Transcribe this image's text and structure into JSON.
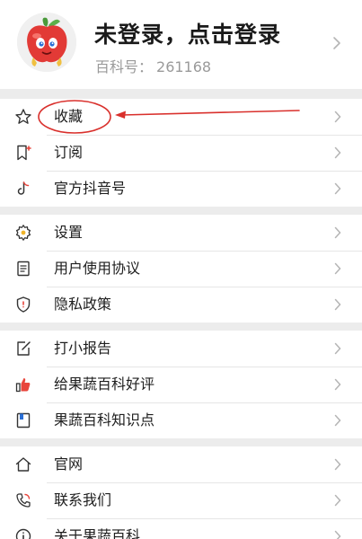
{
  "profile": {
    "title": "未登录，点击登录",
    "id_label": "百科号：",
    "id_value": "261168"
  },
  "groups": [
    {
      "items": [
        {
          "label": "收藏",
          "icon": "star-icon"
        },
        {
          "label": "订阅",
          "icon": "bookmark-plus-icon"
        },
        {
          "label": "官方抖音号",
          "icon": "tiktok-icon"
        }
      ]
    },
    {
      "items": [
        {
          "label": "设置",
          "icon": "gear-icon"
        },
        {
          "label": "用户使用协议",
          "icon": "document-icon"
        },
        {
          "label": "隐私政策",
          "icon": "shield-icon"
        }
      ]
    },
    {
      "items": [
        {
          "label": "打小报告",
          "icon": "edit-icon"
        },
        {
          "label": "给果蔬百科好评",
          "icon": "thumbs-up-icon"
        },
        {
          "label": "果蔬百科知识点",
          "icon": "book-icon"
        }
      ]
    },
    {
      "items": [
        {
          "label": "官网",
          "icon": "home-icon"
        },
        {
          "label": "联系我们",
          "icon": "phone-icon"
        },
        {
          "label": "关于果蔬百科",
          "icon": "info-icon"
        }
      ]
    }
  ],
  "colors": {
    "annotation": "#d9302c",
    "accent_red": "#e8453c"
  }
}
